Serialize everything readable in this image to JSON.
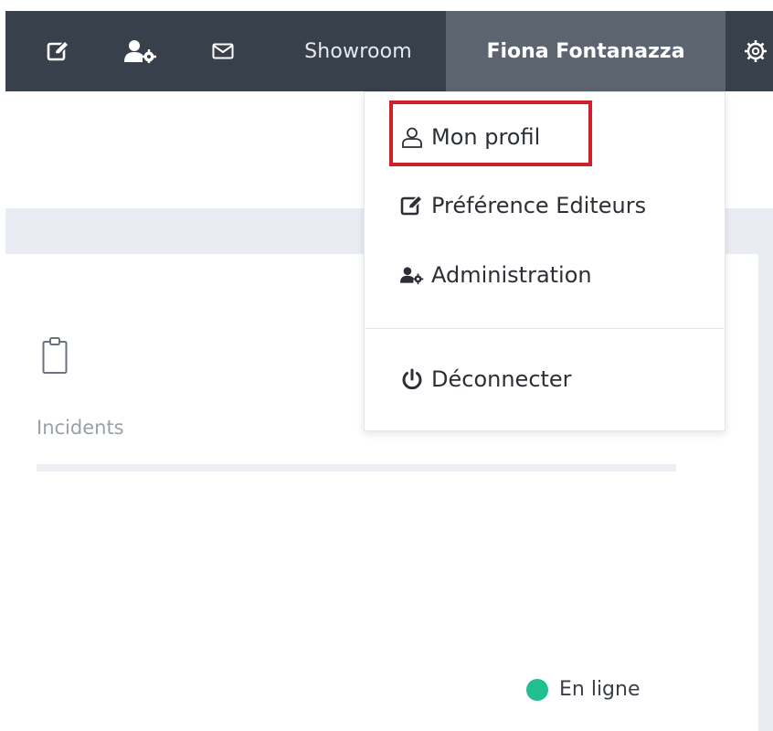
{
  "navbar": {
    "edit_icon": "edit-square-icon",
    "admin_icon": "user-gear-icon",
    "mail_icon": "envelope-icon",
    "showroom_label": "Showroom",
    "user_name": "Fiona Fontanazza",
    "settings_icon": "gear-icon",
    "background_color": "#38404c",
    "active_color": "#5c6470"
  },
  "user_menu": {
    "items": [
      {
        "label": "Mon profil",
        "icon": "user-outline-icon",
        "highlighted": true
      },
      {
        "label": "Préférence Editeurs",
        "icon": "edit-square-icon"
      },
      {
        "label": "Administration",
        "icon": "user-gear-icon"
      },
      {
        "label": "Déconnecter",
        "icon": "power-icon"
      }
    ],
    "highlight_color": "#d0212a"
  },
  "content": {
    "card_icon": "clipboard-icon",
    "incidents_label": "Incidents",
    "status_label": "En ligne",
    "status_color": "#1fbf8f"
  }
}
